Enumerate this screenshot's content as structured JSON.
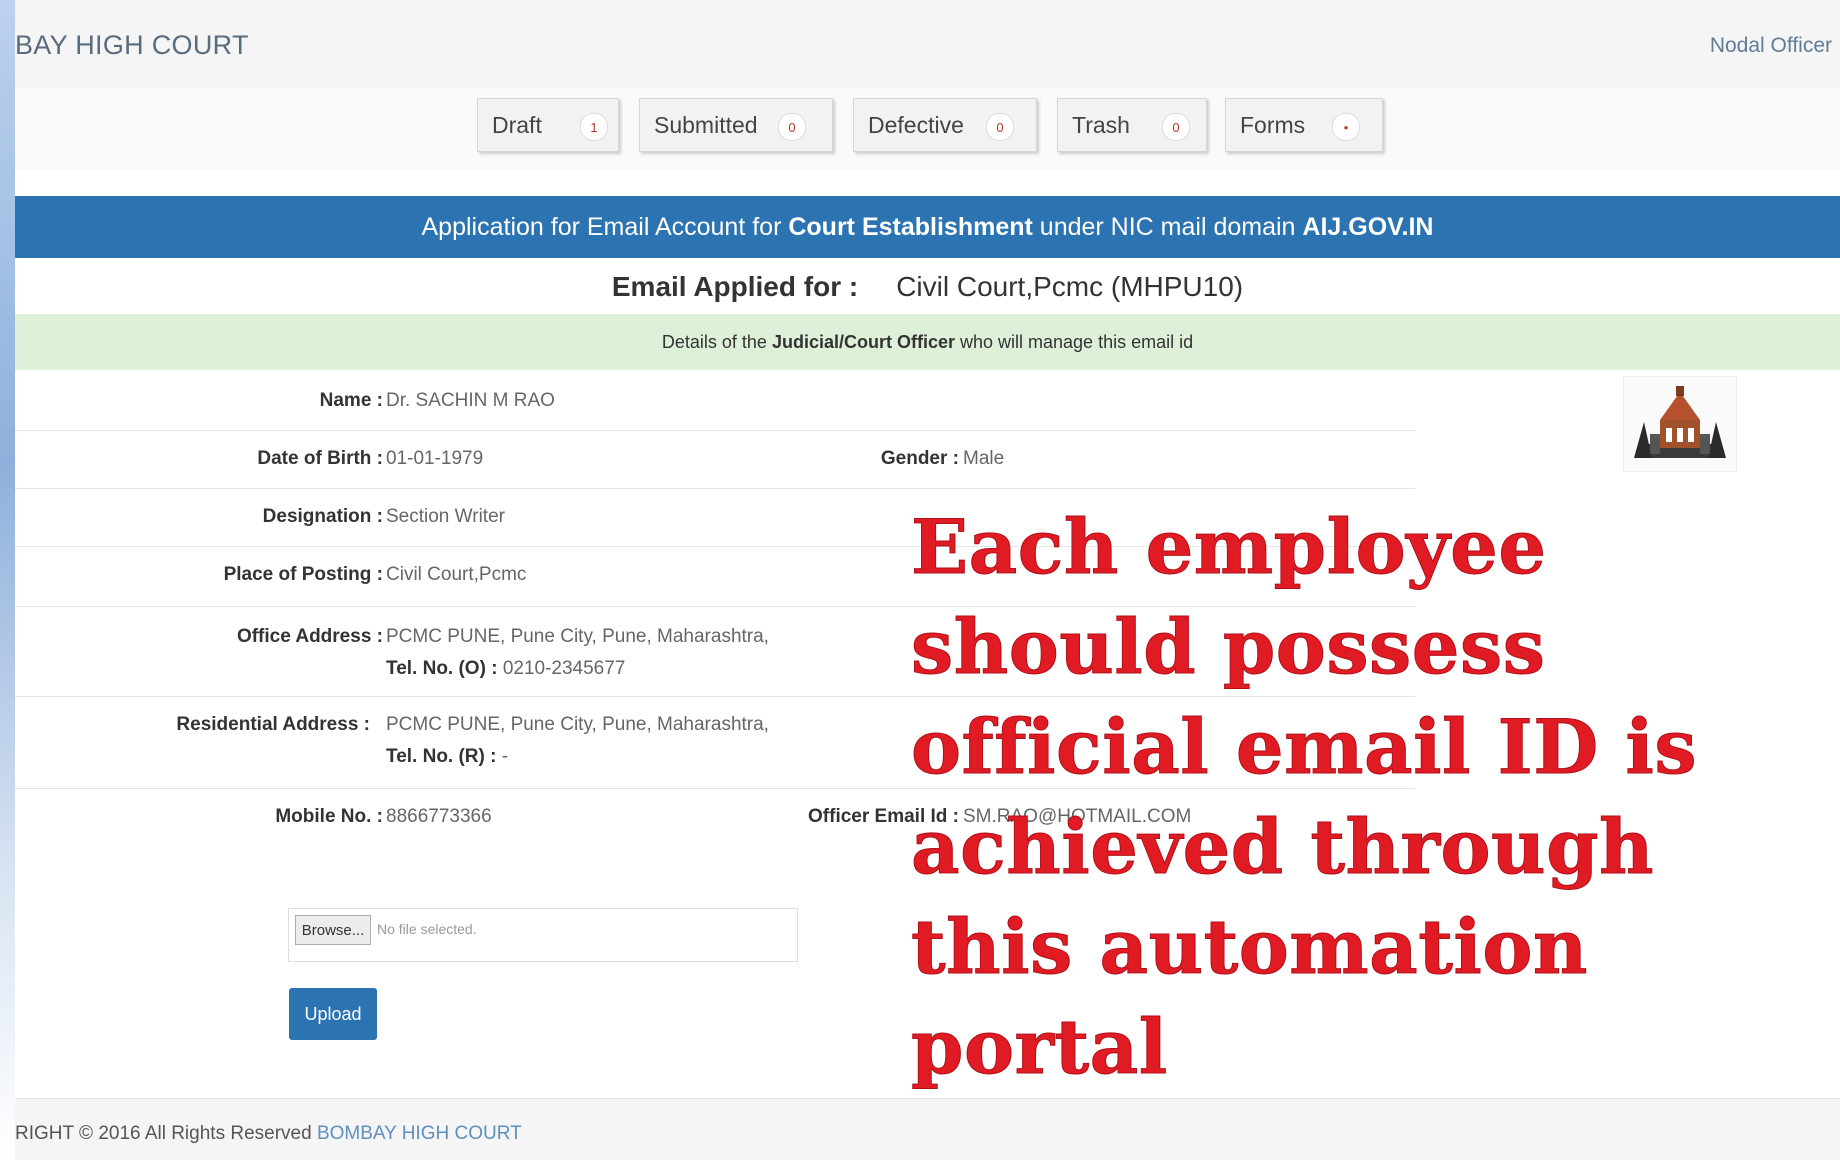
{
  "header": {
    "brand": "BAY HIGH COURT",
    "nodal_link": "Nodal Officer"
  },
  "tabs": [
    {
      "label": "Draft",
      "count": "1"
    },
    {
      "label": "Submitted",
      "count": "0"
    },
    {
      "label": "Defective",
      "count": "0"
    },
    {
      "label": "Trash",
      "count": "0"
    },
    {
      "label": "Forms",
      "count": "•"
    }
  ],
  "banner": {
    "text_1": "Application for Email Account for ",
    "bold_1": "Court Establishment",
    "text_2": " under NIC mail domain ",
    "bold_2": "AIJ.GOV.IN"
  },
  "applied": {
    "label": "Email Applied for :",
    "value": "Civil Court,Pcmc (MHPU10)"
  },
  "officer_banner": {
    "text_1": "Details of the ",
    "bold": "Judicial/Court Officer",
    "text_2": " who will manage this email id"
  },
  "fields": {
    "name_label": "Name :",
    "name_value": "Dr. SACHIN M RAO",
    "dob_label": "Date of Birth :",
    "dob_value": "01-01-1979",
    "gender_label": "Gender :",
    "gender_value": "Male",
    "designation_label": "Designation :",
    "designation_value": "Section Writer",
    "posting_label": "Place of Posting :",
    "posting_value": "Civil Court,Pcmc",
    "office_label": "Office Address :",
    "office_value": "PCMC PUNE, Pune City, Pune, Maharashtra,",
    "office_tel_label": "Tel. No. (O) :",
    "office_tel_value": "0210-2345677",
    "res_label": "Residential Address :",
    "res_value": "PCMC PUNE, Pune City, Pune, Maharashtra,",
    "res_tel_label": "Tel. No. (R) :",
    "res_tel_value": "-",
    "mobile_label": "Mobile No. :",
    "mobile_value": "8866773366",
    "email_label": "Officer Email Id :",
    "email_value": "SM.RAO@HOTMAIL.COM"
  },
  "upload": {
    "browse_label": "Browse...",
    "no_file": "No file selected.",
    "upload_label": "Upload"
  },
  "overlay_lines": [
    "Each employee",
    "should possess",
    "official email ID is",
    "achieved through",
    "this automation",
    "portal"
  ],
  "footer": {
    "text": "RIGHT © 2016 All Rights Reserved ",
    "link": "BOMBAY HIGH COURT"
  },
  "colors": {
    "primary_blue": "#2c73b2",
    "green_banner": "#dff0d8",
    "overlay_red": "#e01b24"
  }
}
